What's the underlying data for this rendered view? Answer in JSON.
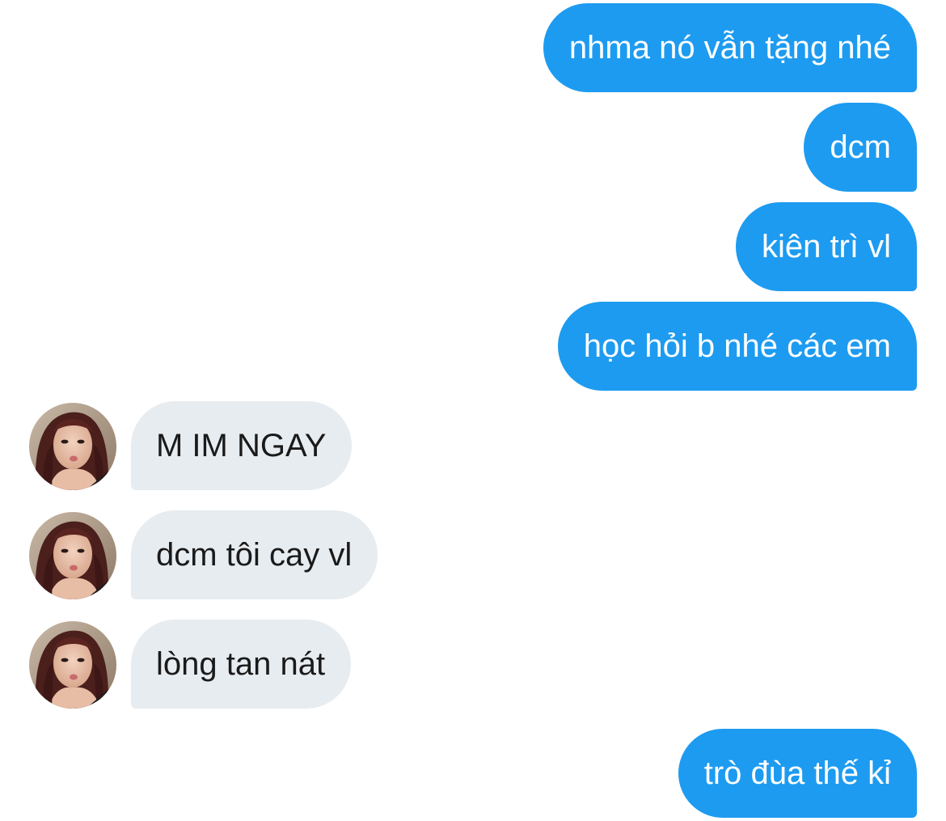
{
  "conversation": {
    "messages": [
      {
        "sender": "me",
        "text": "nhma nó vẫn tặng nhé"
      },
      {
        "sender": "me",
        "text": "dcm"
      },
      {
        "sender": "me",
        "text": "kiên trì vl"
      },
      {
        "sender": "me",
        "text": "học hỏi b nhé các em"
      },
      {
        "sender": "other",
        "text": "M IM NGAY"
      },
      {
        "sender": "other",
        "text": "dcm tôi cay vl"
      },
      {
        "sender": "other",
        "text": "lòng tan nát"
      },
      {
        "sender": "me",
        "text": "trò đùa thế kỉ"
      }
    ]
  },
  "colors": {
    "outgoing_bubble": "#1d9bf0",
    "incoming_bubble": "#e7ecf0",
    "outgoing_text": "#ffffff",
    "incoming_text": "#1a1a1a",
    "background": "#ffffff"
  },
  "icons": {
    "avatar": "user-avatar-photo"
  }
}
